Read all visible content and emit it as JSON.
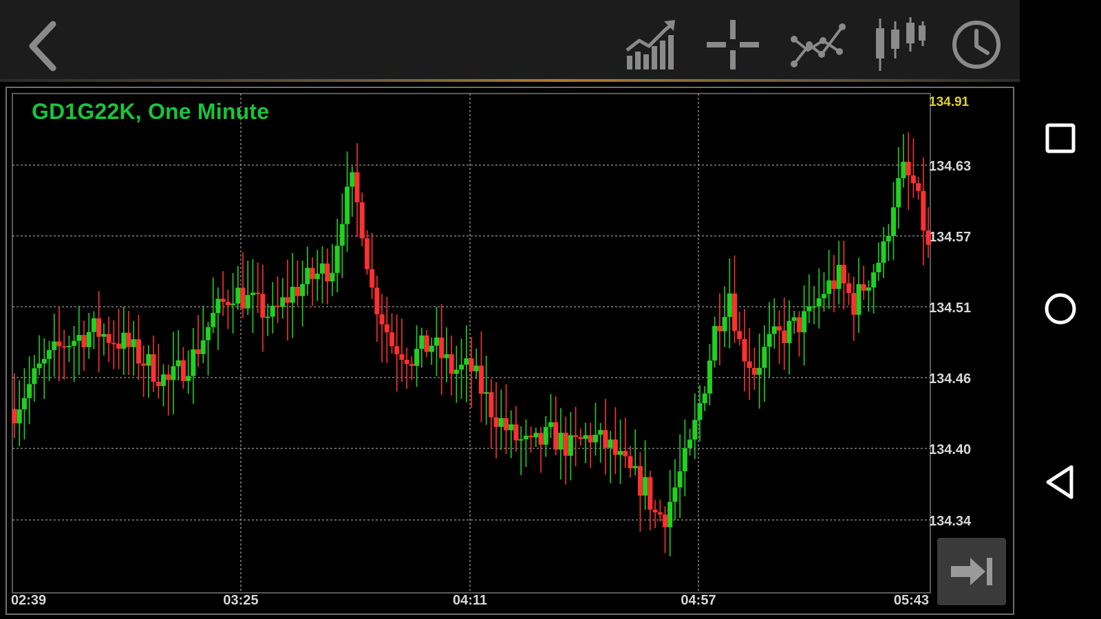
{
  "toolbar": {
    "back_icon": "chevron-left-icon",
    "icons": [
      "indicators-icon",
      "crosshair-icon",
      "objects-icon",
      "chart-type-icon",
      "timeframe-icon"
    ]
  },
  "navbar": {
    "icons": [
      "recent-apps-icon",
      "home-icon",
      "back-triangle-icon"
    ]
  },
  "colors": {
    "bull": "#1fd21f",
    "bear": "#ff3030",
    "title": "#19c43a",
    "last_price": "#e3d21a",
    "grid": "#9a9a9a",
    "axis_text": "#d8d8d8"
  },
  "chart_data": {
    "type": "candlestick",
    "title": "GD1G22K, One Minute",
    "symbol": "GD1G22K",
    "timeframe": "One Minute",
    "price_axis_labels": [
      "134.91",
      "134.63",
      "134.57",
      "134.51",
      "134.46",
      "134.40",
      "134.34"
    ],
    "last_price": 134.91,
    "y_ticks": [
      134.63,
      134.57,
      134.51,
      134.46,
      134.4,
      134.34
    ],
    "time_axis_labels": [
      "02:39",
      "03:25",
      "04:11",
      "04:57",
      "05:43"
    ],
    "ylim": [
      134.3,
      134.68
    ],
    "grid": true,
    "price_path": [
      [
        0,
        134.44
      ],
      [
        5,
        134.47
      ],
      [
        10,
        134.49
      ],
      [
        16,
        134.5
      ],
      [
        22,
        134.49
      ],
      [
        28,
        134.47
      ],
      [
        31,
        134.46
      ],
      [
        36,
        134.48
      ],
      [
        40,
        134.51
      ],
      [
        44,
        134.53
      ],
      [
        48,
        134.52
      ],
      [
        52,
        134.51
      ],
      [
        56,
        134.53
      ],
      [
        60,
        134.54
      ],
      [
        64,
        134.55
      ],
      [
        66,
        134.59
      ],
      [
        68,
        134.61
      ],
      [
        70,
        134.58
      ],
      [
        72,
        134.53
      ],
      [
        76,
        134.49
      ],
      [
        80,
        134.48
      ],
      [
        84,
        134.49
      ],
      [
        88,
        134.47
      ],
      [
        92,
        134.47
      ],
      [
        96,
        134.44
      ],
      [
        100,
        134.42
      ],
      [
        104,
        134.41
      ],
      [
        108,
        134.42
      ],
      [
        112,
        134.41
      ],
      [
        116,
        134.42
      ],
      [
        120,
        134.41
      ],
      [
        124,
        134.39
      ],
      [
        127,
        134.38
      ],
      [
        129,
        134.36
      ],
      [
        131,
        134.36
      ],
      [
        133,
        134.38
      ],
      [
        136,
        134.41
      ],
      [
        139,
        134.46
      ],
      [
        141,
        134.5
      ],
      [
        144,
        134.53
      ],
      [
        146,
        134.49
      ],
      [
        149,
        134.47
      ],
      [
        152,
        134.49
      ],
      [
        156,
        134.5
      ],
      [
        160,
        134.51
      ],
      [
        163,
        134.53
      ],
      [
        166,
        134.54
      ],
      [
        169,
        134.52
      ],
      [
        172,
        134.54
      ],
      [
        175,
        134.56
      ],
      [
        177,
        134.6
      ],
      [
        179,
        134.62
      ],
      [
        181,
        134.61
      ],
      [
        183,
        134.58
      ],
      [
        184,
        134.56
      ]
    ]
  }
}
